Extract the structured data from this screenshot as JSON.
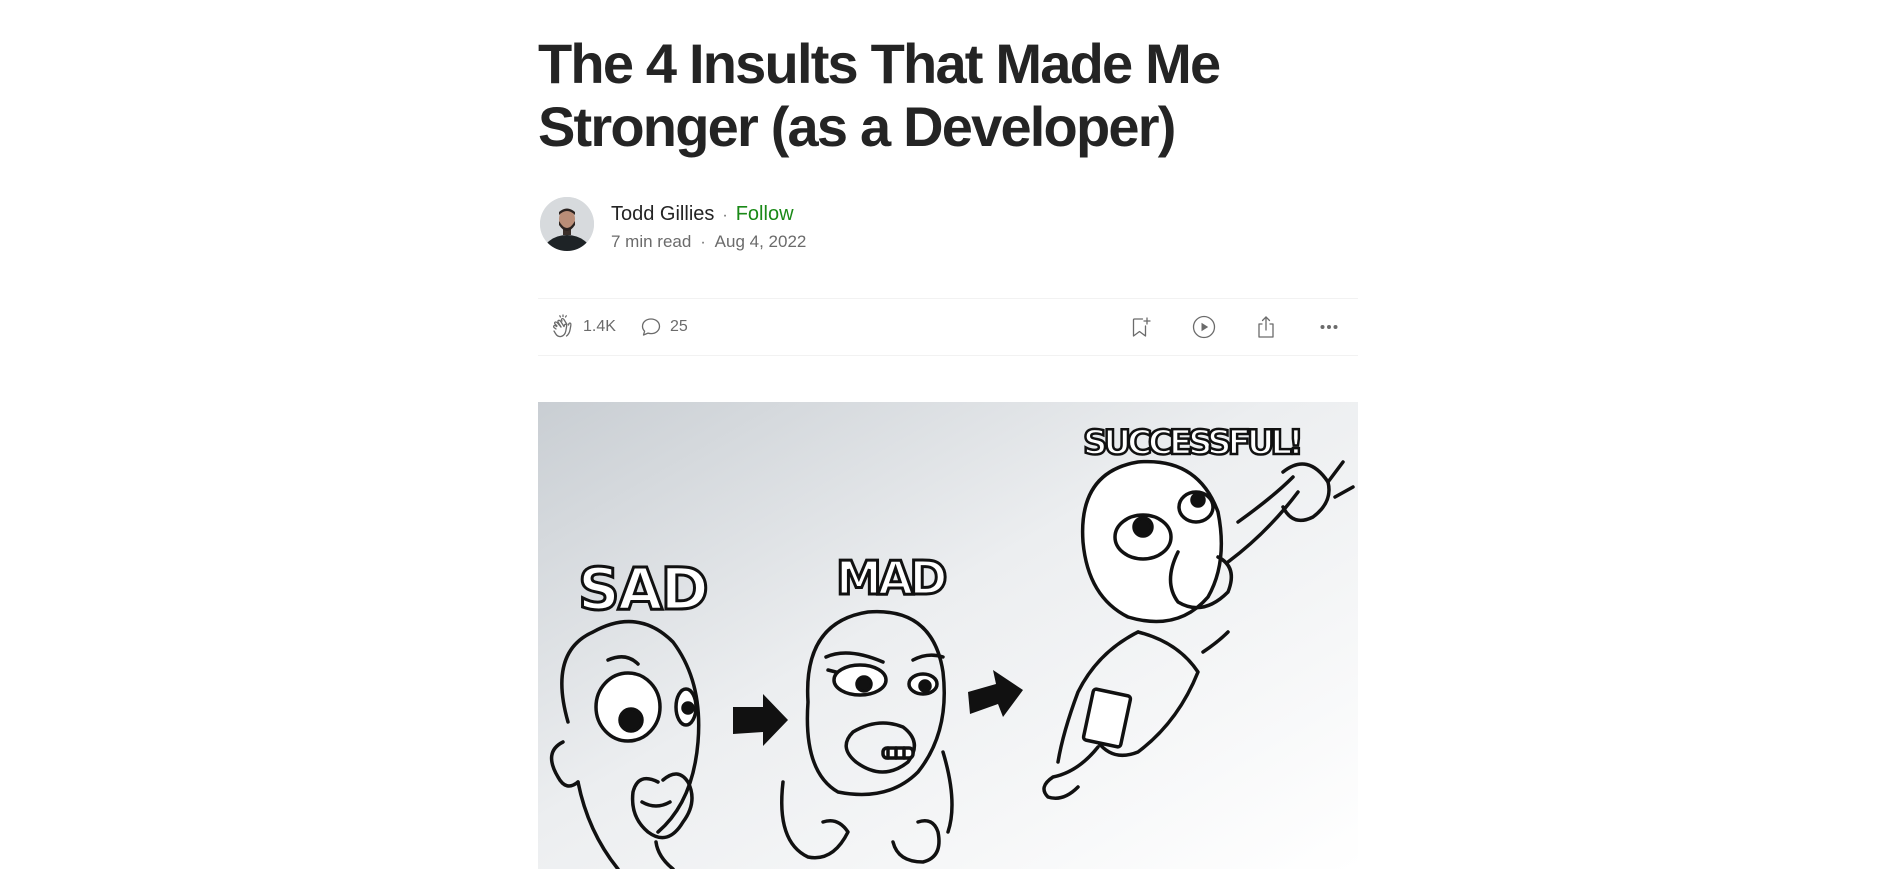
{
  "article": {
    "title_line1": "The 4 Insults That Made Me",
    "title_line2": "Stronger (as a Developer)"
  },
  "author": {
    "name": "Todd Gillies",
    "separator": "·",
    "follow_label": "Follow"
  },
  "meta": {
    "read_time": "7 min read",
    "separator": "·",
    "date": "Aug 4, 2022"
  },
  "actions": {
    "claps": "1.4K",
    "responses": "25",
    "icons": [
      "clap-icon",
      "response-icon",
      "bookmark-icon",
      "listen-icon",
      "share-icon",
      "more-icon"
    ]
  },
  "hero_image": {
    "labels": {
      "sad": "SAD",
      "mad": "MAD",
      "successful": "SUCCESSFUL!"
    }
  },
  "colors": {
    "text": "#242424",
    "muted": "#6b6b6b",
    "follow": "#1a8917",
    "divider": "#f2f2f2"
  }
}
